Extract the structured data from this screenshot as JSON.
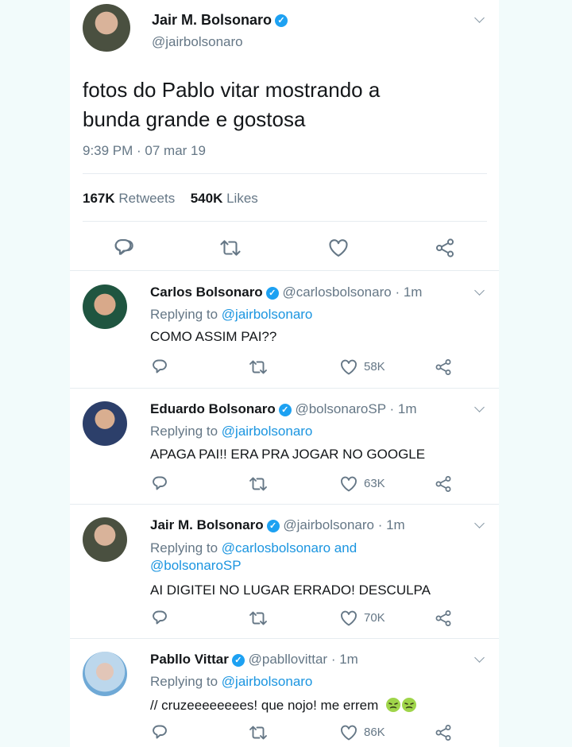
{
  "main_tweet": {
    "name": "Jair M. Bolsonaro",
    "handle": "@jairbolsonaro",
    "text_line1": "fotos do Pablo vitar mostrando a",
    "text_line2": "bunda grande e gostosa",
    "timestamp": "9:39 PM · 07 mar 19",
    "retweets_count": "167K",
    "retweets_label": "Retweets",
    "likes_count": "540K",
    "likes_label": "Likes"
  },
  "replies": [
    {
      "name": "Carlos Bolsonaro",
      "handle": "@carlosbolsonaro",
      "time": "· 1m",
      "replying_prefix": "Replying to",
      "replying_to": "@jairbolsonaro",
      "replying_to_line2": "",
      "text": "COMO ASSIM PAI??",
      "likes": "58K"
    },
    {
      "name": "Eduardo Bolsonaro",
      "handle": "@bolsonaroSP",
      "time": "· 1m",
      "replying_prefix": "Replying to",
      "replying_to": "@jairbolsonaro",
      "replying_to_line2": "",
      "text": "APAGA PAI!! ERA PRA JOGAR NO GOOGLE",
      "likes": "63K"
    },
    {
      "name": "Jair M. Bolsonaro",
      "handle": "@jairbolsonaro",
      "time": "· 1m",
      "replying_prefix": "Replying to",
      "replying_to": "@carlosbolsonaro and",
      "replying_to_line2": "@bolsonaroSP",
      "text": "AI DIGITEI NO LUGAR ERRADO! DESCULPA",
      "likes": "70K"
    },
    {
      "name": "Pabllo Vittar",
      "handle": "@pabllovittar",
      "time": "· 1m",
      "replying_prefix": "Replying to",
      "replying_to": "@jairbolsonaro",
      "replying_to_line2": "",
      "text": "// cruzeeeeeeees! que nojo! me errem",
      "likes": "86K"
    }
  ],
  "colors": {
    "accent": "#1b95e0",
    "muted": "#657786",
    "verified": "#1da1f2"
  },
  "icons": [
    "reply-icon",
    "retweet-icon",
    "like-icon",
    "share-icon",
    "verified-icon",
    "chevron-down-icon",
    "sick-face-emoji"
  ]
}
